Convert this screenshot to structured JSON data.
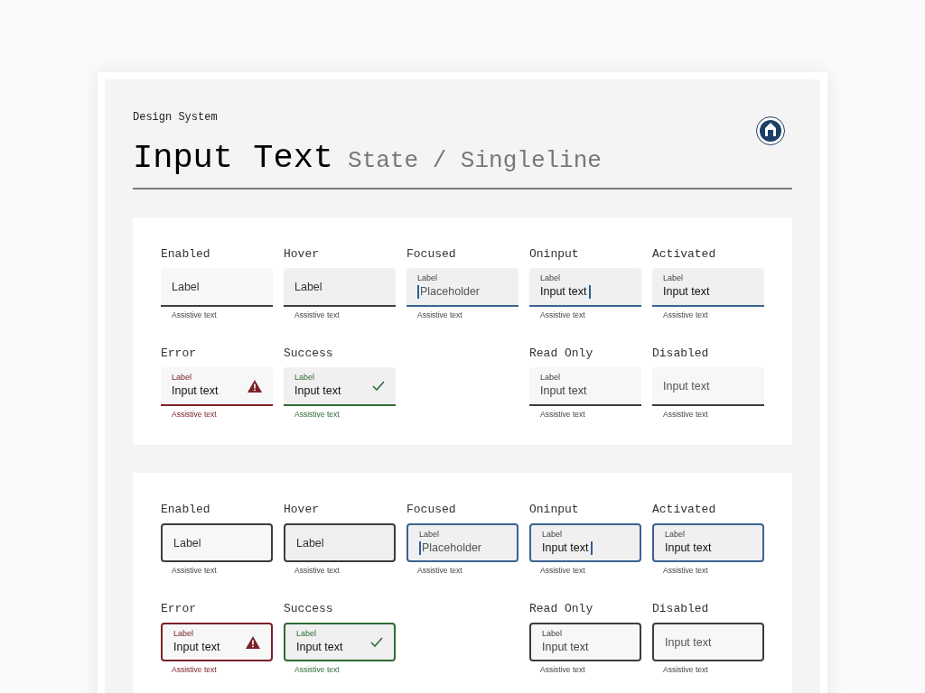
{
  "header": {
    "eyebrow": "Design System",
    "title": "Input Text",
    "subtitle": "State / Singleline"
  },
  "sections": [
    {
      "kind": "underline",
      "rows": [
        {
          "fields": [
            {
              "kind": "enabled",
              "title": "Enabled",
              "label": "Label",
              "assistive": "Assistive text"
            },
            {
              "kind": "hover",
              "title": "Hover",
              "label": "Label",
              "assistive": "Assistive text"
            },
            {
              "kind": "focused",
              "title": "Focused",
              "label": "Label",
              "placeholder": "Placeholder",
              "assistive": "Assistive text"
            },
            {
              "kind": "oninput",
              "title": "Oninput",
              "label": "Label",
              "value": "Input text",
              "assistive": "Assistive text"
            },
            {
              "kind": "activated",
              "title": "Activated",
              "label": "Label",
              "value": "Input text",
              "assistive": "Assistive text"
            }
          ]
        },
        {
          "fields": [
            {
              "kind": "error",
              "title": "Error",
              "label": "Label",
              "value": "Input text",
              "assistive": "Assistive text"
            },
            {
              "kind": "success",
              "title": "Success",
              "label": "Label",
              "value": "Input text",
              "assistive": "Assistive text"
            },
            {
              "kind": "readonly",
              "title": "Read Only",
              "label": "Label",
              "value": "Input text",
              "assistive": "Assistive text"
            },
            {
              "kind": "disabled",
              "title": "Disabled",
              "value": "Input text",
              "assistive": "Assistive text"
            }
          ]
        }
      ]
    },
    {
      "kind": "outlined",
      "rows": [
        {
          "fields": [
            {
              "kind": "enabled",
              "title": "Enabled",
              "label": "Label",
              "assistive": "Assistive text"
            },
            {
              "kind": "hover",
              "title": "Hover",
              "label": "Label",
              "assistive": "Assistive text"
            },
            {
              "kind": "focused",
              "title": "Focused",
              "label": "Label",
              "placeholder": "Placeholder",
              "assistive": "Assistive text"
            },
            {
              "kind": "oninput",
              "title": "Oninput",
              "label": "Label",
              "value": "Input text",
              "assistive": "Assistive text"
            },
            {
              "kind": "activated",
              "title": "Activated",
              "label": "Label",
              "value": "Input text",
              "assistive": "Assistive text"
            }
          ]
        },
        {
          "fields": [
            {
              "kind": "error",
              "title": "Error",
              "label": "Label",
              "value": "Input text",
              "assistive": "Assistive text"
            },
            {
              "kind": "success",
              "title": "Success",
              "label": "Label",
              "value": "Input text",
              "assistive": "Assistive text"
            },
            {
              "kind": "readonly",
              "title": "Read Only",
              "label": "Label",
              "value": "Input text",
              "assistive": "Assistive text"
            },
            {
              "kind": "disabled",
              "title": "Disabled",
              "value": "Input text",
              "assistive": "Assistive text"
            }
          ]
        }
      ]
    }
  ]
}
